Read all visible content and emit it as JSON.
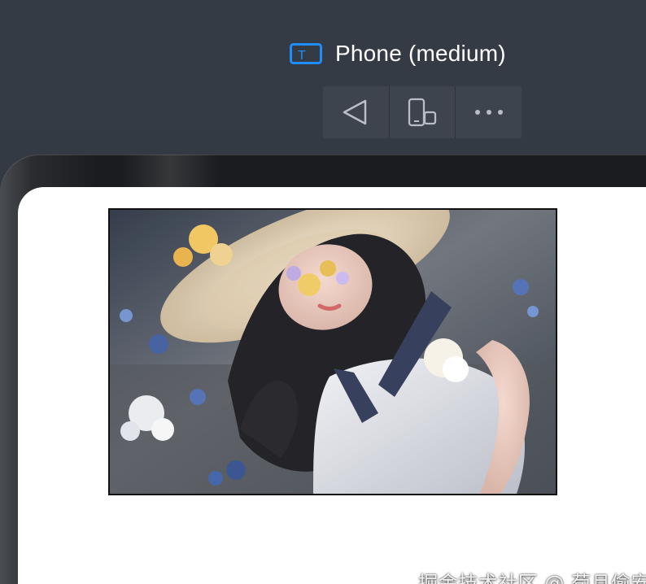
{
  "device": {
    "label": "Phone (medium)",
    "icon": "text-device-icon",
    "accent": "#1f8cff"
  },
  "toolbar": {
    "buttons": [
      {
        "name": "rotate-back",
        "icon": "triangle-back-icon"
      },
      {
        "name": "device-switch",
        "icon": "device-rotate-icon"
      },
      {
        "name": "more-options",
        "icon": "more-dots-icon"
      }
    ]
  },
  "content": {
    "image_alt": "Illustration of a woman with a straw hat lying among flowers",
    "watermark": "掘金技术社区 @ 苟且偷安"
  }
}
